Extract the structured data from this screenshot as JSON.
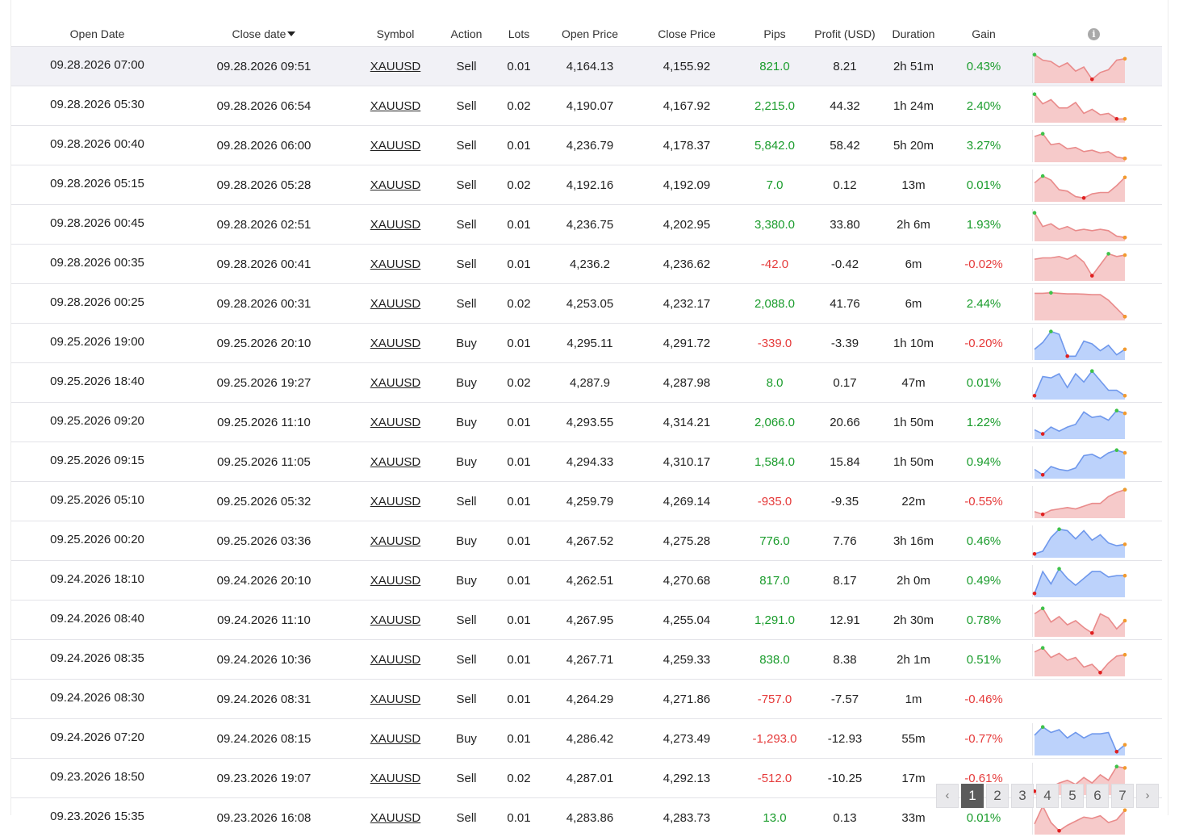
{
  "table": {
    "headers": {
      "open_date": "Open Date",
      "close_date": "Close date",
      "symbol": "Symbol",
      "action": "Action",
      "lots": "Lots",
      "open_price": "Open Price",
      "close_price": "Close Price",
      "pips": "Pips",
      "profit": "Profit (USD)",
      "duration": "Duration",
      "gain": "Gain",
      "info_icon": "i"
    },
    "sort": {
      "column": "close_date",
      "direction": "descending"
    },
    "rows": [
      {
        "open": "09.28.2026 07:00",
        "close": "09.28.2026 09:51",
        "symbol": "XAUUSD",
        "action": "Sell",
        "lots": "0.01",
        "open_price": "4,164.13",
        "close_price": "4,155.92",
        "pips": "821.0",
        "profit": "8.21",
        "duration": "2h 51m",
        "gain": "0.43%",
        "positive": true,
        "spark": {
          "kind": "sell",
          "points": [
            0.95,
            0.75,
            0.7,
            0.5,
            0.65,
            0.35,
            0.5,
            0.05,
            0.3,
            0.4,
            0.75,
            0.8
          ]
        }
      },
      {
        "open": "09.28.2026 05:30",
        "close": "09.28.2026 06:54",
        "symbol": "XAUUSD",
        "action": "Sell",
        "lots": "0.02",
        "open_price": "4,190.07",
        "close_price": "4,167.92",
        "pips": "2,215.0",
        "profit": "44.32",
        "duration": "1h 24m",
        "gain": "2.40%",
        "positive": true,
        "spark": {
          "kind": "sell",
          "points": [
            0.95,
            0.6,
            0.75,
            0.45,
            0.45,
            0.65,
            0.25,
            0.4,
            0.2,
            0.25,
            0.05,
            0.05
          ]
        }
      },
      {
        "open": "09.28.2026 00:40",
        "close": "09.28.2026 06:00",
        "symbol": "XAUUSD",
        "action": "Sell",
        "lots": "0.01",
        "open_price": "4,236.79",
        "close_price": "4,178.37",
        "pips": "5,842.0",
        "profit": "58.42",
        "duration": "5h 20m",
        "gain": "3.27%",
        "positive": true,
        "spark": {
          "kind": "sell",
          "points": [
            0.85,
            0.95,
            0.55,
            0.6,
            0.4,
            0.45,
            0.3,
            0.35,
            0.25,
            0.3,
            0.1,
            0.05
          ]
        }
      },
      {
        "open": "09.28.2026 05:15",
        "close": "09.28.2026 05:28",
        "symbol": "XAUUSD",
        "action": "Sell",
        "lots": "0.02",
        "open_price": "4,192.16",
        "close_price": "4,192.09",
        "pips": "7.0",
        "profit": "0.12",
        "duration": "13m",
        "gain": "0.01%",
        "positive": true,
        "spark": {
          "kind": "sell",
          "points": [
            0.6,
            0.85,
            0.7,
            0.35,
            0.3,
            0.1,
            0.05,
            0.2,
            0.25,
            0.25,
            0.5,
            0.8
          ]
        }
      },
      {
        "open": "09.28.2026 00:45",
        "close": "09.28.2026 02:51",
        "symbol": "XAUUSD",
        "action": "Sell",
        "lots": "0.01",
        "open_price": "4,236.75",
        "close_price": "4,202.95",
        "pips": "3,380.0",
        "profit": "33.80",
        "duration": "2h 6m",
        "gain": "1.93%",
        "positive": true,
        "spark": {
          "kind": "sell",
          "points": [
            0.95,
            0.45,
            0.55,
            0.35,
            0.45,
            0.3,
            0.35,
            0.3,
            0.35,
            0.3,
            0.1,
            0.05
          ]
        }
      },
      {
        "open": "09.28.2026 00:35",
        "close": "09.28.2026 00:41",
        "symbol": "XAUUSD",
        "action": "Sell",
        "lots": "0.01",
        "open_price": "4,236.2",
        "close_price": "4,236.62",
        "pips": "-42.0",
        "profit": "-0.42",
        "duration": "6m",
        "gain": "-0.02%",
        "positive": false,
        "spark": {
          "kind": "sell",
          "points": [
            0.7,
            0.75,
            0.75,
            0.8,
            0.7,
            0.85,
            0.6,
            0.1,
            0.5,
            0.9,
            0.8,
            0.85
          ]
        }
      },
      {
        "open": "09.28.2026 00:25",
        "close": "09.28.2026 00:31",
        "symbol": "XAUUSD",
        "action": "Sell",
        "lots": "0.02",
        "open_price": "4,253.05",
        "close_price": "4,232.17",
        "pips": "2,088.0",
        "profit": "41.76",
        "duration": "6m",
        "gain": "2.44%",
        "positive": true,
        "spark": {
          "kind": "sell",
          "points": [
            0.9,
            0.9,
            0.92,
            0.9,
            0.88,
            0.88,
            0.87,
            0.85,
            0.85,
            0.65,
            0.35,
            0.05
          ]
        }
      },
      {
        "open": "09.25.2026 19:00",
        "close": "09.25.2026 20:10",
        "symbol": "XAUUSD",
        "action": "Buy",
        "lots": "0.01",
        "open_price": "4,295.11",
        "close_price": "4,291.72",
        "pips": "-339.0",
        "profit": "-3.39",
        "duration": "1h 10m",
        "gain": "-0.20%",
        "positive": false,
        "spark": {
          "kind": "buy",
          "points": [
            0.3,
            0.55,
            0.95,
            0.85,
            0.05,
            0.05,
            0.6,
            0.5,
            0.25,
            0.45,
            0.1,
            0.3
          ]
        }
      },
      {
        "open": "09.25.2026 18:40",
        "close": "09.25.2026 19:27",
        "symbol": "XAUUSD",
        "action": "Buy",
        "lots": "0.02",
        "open_price": "4,287.9",
        "close_price": "4,287.98",
        "pips": "8.0",
        "profit": "0.17",
        "duration": "47m",
        "gain": "0.01%",
        "positive": true,
        "spark": {
          "kind": "buy",
          "points": [
            0.05,
            0.75,
            0.7,
            0.85,
            0.35,
            0.85,
            0.55,
            0.95,
            0.6,
            0.25,
            0.25,
            0.05
          ]
        }
      },
      {
        "open": "09.25.2026 09:20",
        "close": "09.25.2026 11:10",
        "symbol": "XAUUSD",
        "action": "Buy",
        "lots": "0.01",
        "open_price": "4,293.55",
        "close_price": "4,314.21",
        "pips": "2,066.0",
        "profit": "20.66",
        "duration": "1h 50m",
        "gain": "1.22%",
        "positive": true,
        "spark": {
          "kind": "buy",
          "points": [
            0.25,
            0.1,
            0.35,
            0.2,
            0.35,
            0.45,
            0.9,
            0.7,
            0.75,
            0.6,
            0.95,
            0.85
          ]
        }
      },
      {
        "open": "09.25.2026 09:15",
        "close": "09.25.2026 11:05",
        "symbol": "XAUUSD",
        "action": "Buy",
        "lots": "0.01",
        "open_price": "4,294.33",
        "close_price": "4,310.17",
        "pips": "1,584.0",
        "profit": "15.84",
        "duration": "1h 50m",
        "gain": "0.94%",
        "positive": true,
        "spark": {
          "kind": "buy",
          "points": [
            0.25,
            0.05,
            0.35,
            0.25,
            0.2,
            0.3,
            0.75,
            0.8,
            0.65,
            0.85,
            0.95,
            0.85
          ]
        }
      },
      {
        "open": "09.25.2026 05:10",
        "close": "09.25.2026 05:32",
        "symbol": "XAUUSD",
        "action": "Sell",
        "lots": "0.01",
        "open_price": "4,259.79",
        "close_price": "4,269.14",
        "pips": "-935.0",
        "profit": "-9.35",
        "duration": "22m",
        "gain": "-0.55%",
        "positive": false,
        "spark": {
          "kind": "sell",
          "points": [
            0.15,
            0.05,
            0.2,
            0.25,
            0.3,
            0.25,
            0.35,
            0.45,
            0.45,
            0.7,
            0.85,
            0.95
          ]
        }
      },
      {
        "open": "09.25.2026 00:20",
        "close": "09.25.2026 03:36",
        "symbol": "XAUUSD",
        "action": "Buy",
        "lots": "0.01",
        "open_price": "4,267.52",
        "close_price": "4,275.28",
        "pips": "776.0",
        "profit": "7.76",
        "duration": "3h 16m",
        "gain": "0.46%",
        "positive": true,
        "spark": {
          "kind": "buy",
          "points": [
            0.05,
            0.15,
            0.65,
            0.95,
            0.9,
            0.6,
            0.9,
            0.55,
            0.75,
            0.45,
            0.35,
            0.4
          ]
        }
      },
      {
        "open": "09.24.2026 18:10",
        "close": "09.24.2026 20:10",
        "symbol": "XAUUSD",
        "action": "Buy",
        "lots": "0.01",
        "open_price": "4,262.51",
        "close_price": "4,270.68",
        "pips": "817.0",
        "profit": "8.17",
        "duration": "2h 0m",
        "gain": "0.49%",
        "positive": true,
        "spark": {
          "kind": "buy",
          "points": [
            0.05,
            0.85,
            0.4,
            0.95,
            0.6,
            0.35,
            0.6,
            0.85,
            0.85,
            0.65,
            0.7,
            0.7
          ]
        }
      },
      {
        "open": "09.24.2026 08:40",
        "close": "09.24.2026 11:10",
        "symbol": "XAUUSD",
        "action": "Sell",
        "lots": "0.01",
        "open_price": "4,267.95",
        "close_price": "4,255.04",
        "pips": "1,291.0",
        "profit": "12.91",
        "duration": "2h 30m",
        "gain": "0.78%",
        "positive": true,
        "spark": {
          "kind": "sell",
          "points": [
            0.75,
            0.95,
            0.45,
            0.65,
            0.35,
            0.5,
            0.25,
            0.05,
            0.75,
            0.6,
            0.2,
            0.5
          ]
        }
      },
      {
        "open": "09.24.2026 08:35",
        "close": "09.24.2026 10:36",
        "symbol": "XAUUSD",
        "action": "Sell",
        "lots": "0.01",
        "open_price": "4,267.71",
        "close_price": "4,259.33",
        "pips": "838.0",
        "profit": "8.38",
        "duration": "2h 1m",
        "gain": "0.51%",
        "positive": true,
        "spark": {
          "kind": "sell",
          "points": [
            0.8,
            0.95,
            0.6,
            0.75,
            0.5,
            0.6,
            0.25,
            0.35,
            0.05,
            0.4,
            0.65,
            0.7
          ]
        }
      },
      {
        "open": "09.24.2026 08:30",
        "close": "09.24.2026 08:31",
        "symbol": "XAUUSD",
        "action": "Sell",
        "lots": "0.01",
        "open_price": "4,264.29",
        "close_price": "4,271.86",
        "pips": "-757.0",
        "profit": "-7.57",
        "duration": "1m",
        "gain": "-0.46%",
        "positive": false,
        "spark": null
      },
      {
        "open": "09.24.2026 07:20",
        "close": "09.24.2026 08:15",
        "symbol": "XAUUSD",
        "action": "Buy",
        "lots": "0.01",
        "open_price": "4,286.42",
        "close_price": "4,273.49",
        "pips": "-1,293.0",
        "profit": "-12.93",
        "duration": "55m",
        "gain": "-0.77%",
        "positive": false,
        "spark": {
          "kind": "buy",
          "points": [
            0.65,
            0.95,
            0.75,
            0.85,
            0.55,
            0.75,
            0.55,
            0.7,
            0.7,
            0.75,
            0.05,
            0.3
          ]
        }
      },
      {
        "open": "09.23.2026 18:50",
        "close": "09.23.2026 19:07",
        "symbol": "XAUUSD",
        "action": "Sell",
        "lots": "0.02",
        "open_price": "4,287.01",
        "close_price": "4,292.13",
        "pips": "-512.0",
        "profit": "-10.25",
        "duration": "17m",
        "gain": "-0.61%",
        "positive": false,
        "spark": {
          "kind": "sell",
          "points": [
            0.05,
            0.15,
            0.2,
            0.35,
            0.45,
            0.3,
            0.55,
            0.35,
            0.65,
            0.45,
            0.95,
            0.9
          ]
        }
      },
      {
        "open": "09.23.2026 15:35",
        "close": "09.23.2026 16:08",
        "symbol": "XAUUSD",
        "action": "Sell",
        "lots": "0.01",
        "open_price": "4,283.86",
        "close_price": "4,283.73",
        "pips": "13.0",
        "profit": "0.13",
        "duration": "33m",
        "gain": "0.01%",
        "positive": true,
        "spark": {
          "kind": "sell",
          "points": [
            0.3,
            0.95,
            0.35,
            0.05,
            0.25,
            0.4,
            0.55,
            0.5,
            0.6,
            0.35,
            0.45,
            0.8
          ]
        }
      }
    ]
  },
  "colors": {
    "positive": "#1a9c2c",
    "negative": "#e53b3b",
    "sell_fill": "#f6caca",
    "sell_line": "#e98b8b",
    "buy_fill": "#bcd2fb",
    "buy_line": "#6f98ec",
    "spark_max_marker": "#3fc24a",
    "spark_min_marker": "#e02020",
    "spark_end_marker": "#f29a2e"
  },
  "pagination": {
    "prev_icon": "‹",
    "next_icon": "›",
    "pages": [
      "1",
      "2",
      "3",
      "4",
      "5",
      "6",
      "7"
    ],
    "current": "1"
  }
}
